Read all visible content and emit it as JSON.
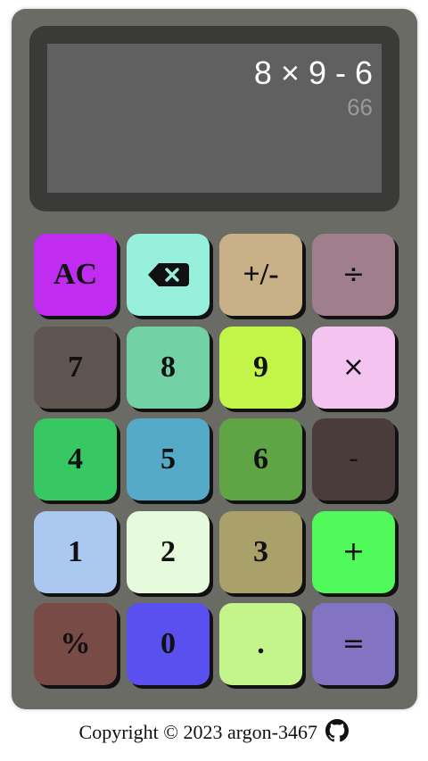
{
  "display": {
    "expression": "8 × 9 - 6",
    "result": "66"
  },
  "keys": [
    {
      "name": "clear-button",
      "label": "AC",
      "color": "#c02cf0",
      "icon": null
    },
    {
      "name": "backspace-button",
      "label": "",
      "color": "#96f0dc",
      "icon": "backspace-icon"
    },
    {
      "name": "negate-button",
      "label": "+/-",
      "color": "#c8b087",
      "icon": null
    },
    {
      "name": "divide-button",
      "label": "÷",
      "color": "#a07e8c",
      "icon": null,
      "op": true
    },
    {
      "name": "digit-7-button",
      "label": "7",
      "color": "#5e5550",
      "icon": null
    },
    {
      "name": "digit-8-button",
      "label": "8",
      "color": "#72d2a5",
      "icon": null
    },
    {
      "name": "digit-9-button",
      "label": "9",
      "color": "#c3f548",
      "icon": null
    },
    {
      "name": "multiply-button",
      "label": "×",
      "color": "#f5c3f0",
      "icon": null,
      "op": true
    },
    {
      "name": "digit-4-button",
      "label": "4",
      "color": "#37c864",
      "icon": null
    },
    {
      "name": "digit-5-button",
      "label": "5",
      "color": "#55aac8",
      "icon": null
    },
    {
      "name": "digit-6-button",
      "label": "6",
      "color": "#5fa546",
      "icon": null
    },
    {
      "name": "subtract-button",
      "label": "-",
      "color": "#4b3c3c",
      "icon": null,
      "op": true
    },
    {
      "name": "digit-1-button",
      "label": "1",
      "color": "#aac8f0",
      "icon": null
    },
    {
      "name": "digit-2-button",
      "label": "2",
      "color": "#e6fadc",
      "icon": null
    },
    {
      "name": "digit-3-button",
      "label": "3",
      "color": "#aaa069",
      "icon": null
    },
    {
      "name": "add-button",
      "label": "+",
      "color": "#50fa5a",
      "icon": null,
      "op": true
    },
    {
      "name": "percent-button",
      "label": "%",
      "color": "#784b46",
      "icon": null
    },
    {
      "name": "digit-0-button",
      "label": "0",
      "color": "#5a50f0",
      "icon": null
    },
    {
      "name": "decimal-button",
      "label": ".",
      "color": "#c3f58c",
      "icon": null
    },
    {
      "name": "equals-button",
      "label": "=",
      "color": "#8273c3",
      "icon": null,
      "op": true
    }
  ],
  "footer": {
    "text": "Copyright © 2023 argon-3467",
    "icon": "github-icon"
  }
}
